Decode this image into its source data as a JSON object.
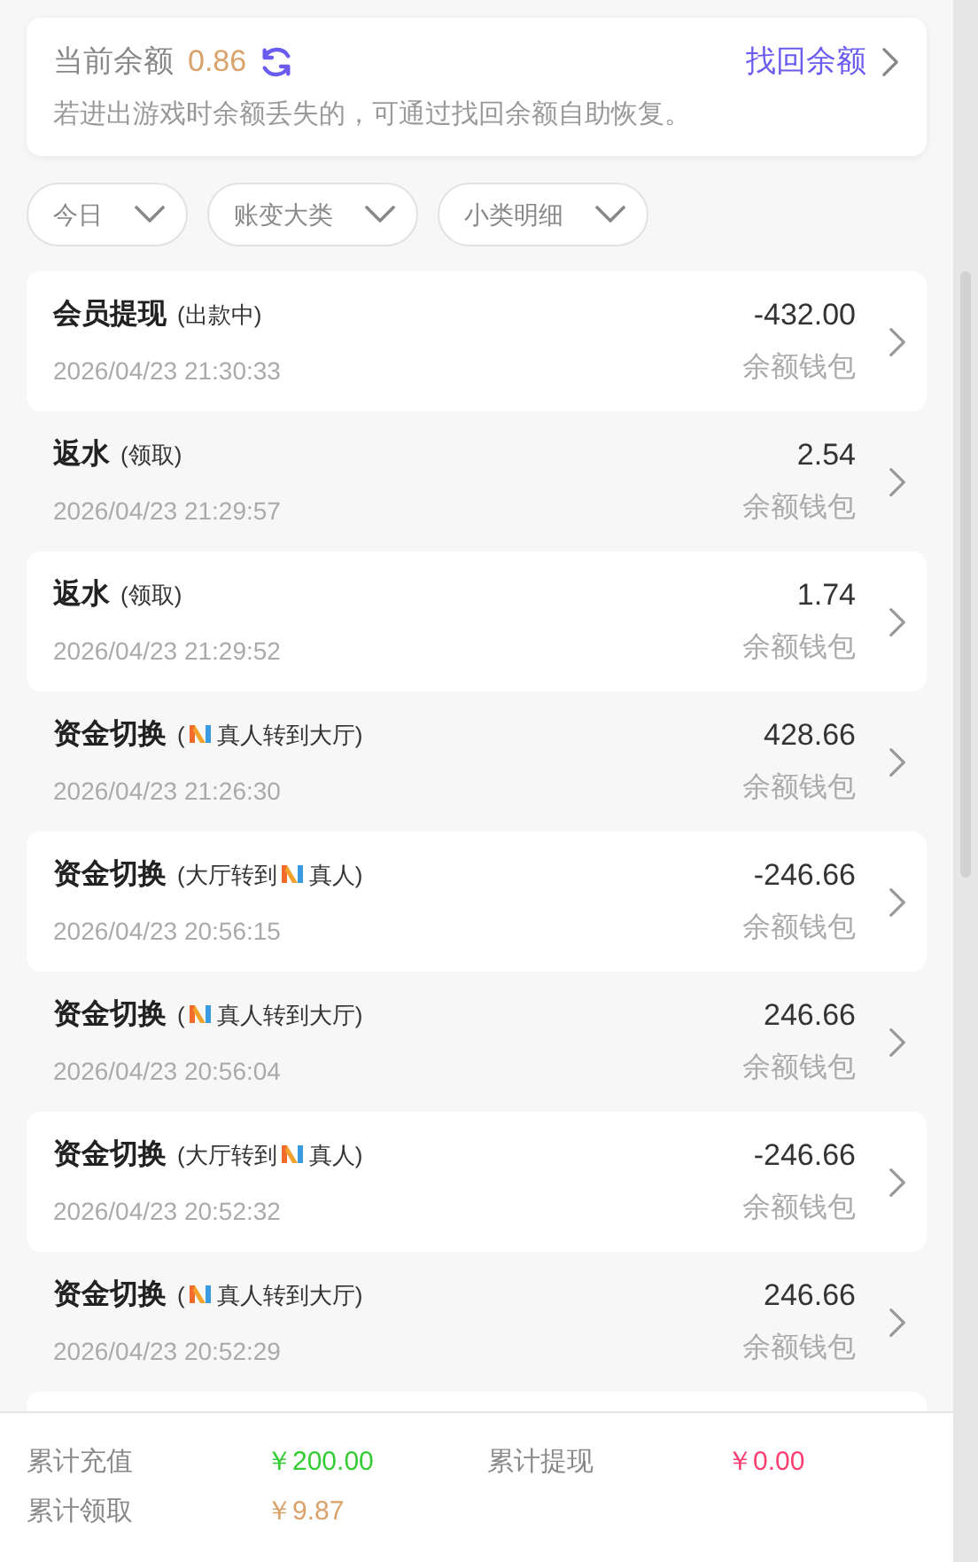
{
  "balance": {
    "label": "当前余额",
    "amount": "0.86",
    "recover_link": "找回余额",
    "hint": "若进出游戏时余额丢失的，可通过找回余额自助恢复。"
  },
  "filters": [
    {
      "label": "今日"
    },
    {
      "label": "账变大类"
    },
    {
      "label": "小类明细"
    }
  ],
  "records": [
    {
      "title": "会员提现",
      "note": [
        {
          "kind": "text",
          "text": "(出款中)"
        }
      ],
      "time": "2026/04/23 21:30:33",
      "amount": "-432.00",
      "wallet": "余额钱包"
    },
    {
      "title": "返水",
      "note": [
        {
          "kind": "text",
          "text": "(领取)"
        }
      ],
      "time": "2026/04/23 21:29:57",
      "amount": "2.54",
      "wallet": "余额钱包"
    },
    {
      "title": "返水",
      "note": [
        {
          "kind": "text",
          "text": "(领取)"
        }
      ],
      "time": "2026/04/23 21:29:52",
      "amount": "1.74",
      "wallet": "余额钱包"
    },
    {
      "title": "资金切换",
      "note": [
        {
          "kind": "text",
          "text": "("
        },
        {
          "kind": "logo"
        },
        {
          "kind": "text",
          "text": "真人转到大厅)"
        }
      ],
      "time": "2026/04/23 21:26:30",
      "amount": "428.66",
      "wallet": "余额钱包"
    },
    {
      "title": "资金切换",
      "note": [
        {
          "kind": "text",
          "text": "(大厅转到"
        },
        {
          "kind": "logo"
        },
        {
          "kind": "text",
          "text": "真人)"
        }
      ],
      "time": "2026/04/23 20:56:15",
      "amount": "-246.66",
      "wallet": "余额钱包"
    },
    {
      "title": "资金切换",
      "note": [
        {
          "kind": "text",
          "text": "("
        },
        {
          "kind": "logo"
        },
        {
          "kind": "text",
          "text": "真人转到大厅)"
        }
      ],
      "time": "2026/04/23 20:56:04",
      "amount": "246.66",
      "wallet": "余额钱包"
    },
    {
      "title": "资金切换",
      "note": [
        {
          "kind": "text",
          "text": "(大厅转到"
        },
        {
          "kind": "logo"
        },
        {
          "kind": "text",
          "text": "真人)"
        }
      ],
      "time": "2026/04/23 20:52:32",
      "amount": "-246.66",
      "wallet": "余额钱包"
    },
    {
      "title": "资金切换",
      "note": [
        {
          "kind": "text",
          "text": "("
        },
        {
          "kind": "logo"
        },
        {
          "kind": "text",
          "text": "真人转到大厅)"
        }
      ],
      "time": "2026/04/23 20:52:29",
      "amount": "246.66",
      "wallet": "余额钱包"
    }
  ],
  "totals": [
    {
      "label": "累计充值",
      "value": "￥200.00",
      "color": "#33cc33"
    },
    {
      "label": "累计提现",
      "value": "￥0.00",
      "color": "#ff3d6e"
    },
    {
      "label": "累计领取",
      "value": "￥9.87",
      "color": "#d9a26b"
    }
  ]
}
